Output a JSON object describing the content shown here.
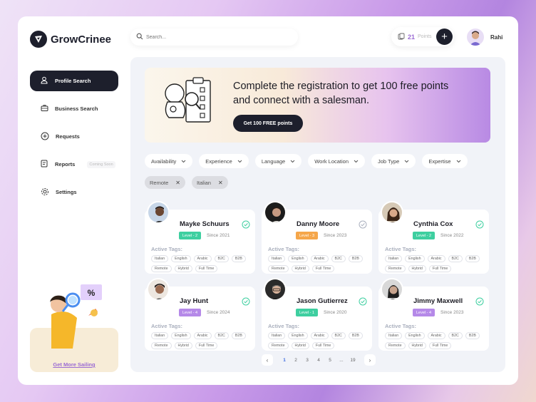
{
  "brand": {
    "name": "GrowCrinee"
  },
  "search": {
    "placeholder": "Search..."
  },
  "points": {
    "count": "21",
    "label": "Points"
  },
  "user": {
    "name": "Rahi"
  },
  "sidebar": {
    "items": [
      {
        "label": "Profile Search",
        "icon": "user-search-icon",
        "active": true
      },
      {
        "label": "Business Search",
        "icon": "briefcase-icon"
      },
      {
        "label": "Requests",
        "icon": "plus-circle-icon"
      },
      {
        "label": "Reports",
        "icon": "report-icon",
        "badge": "Coming Soon"
      },
      {
        "label": "Settings",
        "icon": "gear-icon"
      }
    ],
    "promo_link": "Get More Sailing"
  },
  "banner": {
    "title": "Complete the registration to get 100 free points and connect with a salesman.",
    "button": "Get 100 FREE points"
  },
  "filters": [
    "Availability",
    "Experience",
    "Language",
    "Work Location",
    "Job Type",
    "Expertise"
  ],
  "active_chips": [
    "Remote",
    "Italian"
  ],
  "tags_title": "Active Tags:",
  "cards": [
    {
      "name": "Mayke Schuurs",
      "level": "Level - 2",
      "level_color": "#3ecfa0",
      "since": "Since 2021",
      "verified": true,
      "tags": [
        "Italian",
        "English",
        "Arabic",
        "B2C",
        "B2B",
        "Remote",
        "Hybrid",
        "Full Time"
      ]
    },
    {
      "name": "Danny Moore",
      "level": "Level - 3",
      "level_color": "#f5a64a",
      "since": "Since 2023",
      "verified": false,
      "tags": [
        "Italian",
        "English",
        "Arabic",
        "B2C",
        "B2B",
        "Remote",
        "Hybrid",
        "Full Time"
      ]
    },
    {
      "name": "Cynthia Cox",
      "level": "Level - 2",
      "level_color": "#3ecfa0",
      "since": "Since 2022",
      "verified": true,
      "tags": [
        "Italian",
        "English",
        "Arabic",
        "B2C",
        "B2B",
        "Remote",
        "Hybrid",
        "Full Time"
      ]
    },
    {
      "name": "Jay Hunt",
      "level": "Level - 4",
      "level_color": "#b589e8",
      "since": "Since 2024",
      "verified": true,
      "tags": [
        "Italian",
        "English",
        "Arabic",
        "B2C",
        "B2B",
        "Remote",
        "Hybrid",
        "Full Time"
      ]
    },
    {
      "name": "Jason Gutierrez",
      "level": "Level - 1",
      "level_color": "#3ecfa0",
      "since": "Since 2020",
      "verified": true,
      "tags": [
        "Italian",
        "English",
        "Arabic",
        "B2C",
        "B2B",
        "Remote",
        "Hybrid",
        "Full Time"
      ]
    },
    {
      "name": "Jimmy Maxwell",
      "level": "Level - 4",
      "level_color": "#b589e8",
      "since": "Since 2023",
      "verified": true,
      "tags": [
        "Italian",
        "English",
        "Arabic",
        "B2C",
        "B2B",
        "Remote",
        "Hybrid",
        "Full Time"
      ]
    }
  ],
  "pagination": {
    "pages": [
      "1",
      "2",
      "3",
      "4",
      "5",
      "...",
      "19"
    ],
    "current": "1"
  }
}
